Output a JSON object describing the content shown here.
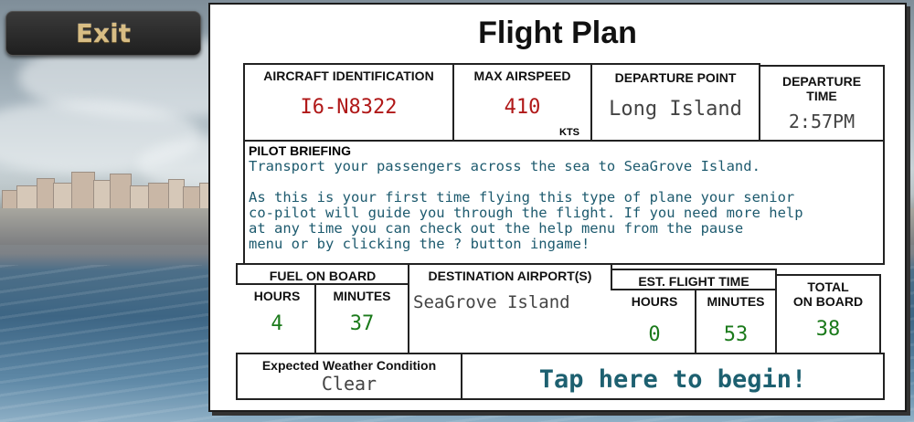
{
  "exit_button": {
    "label": "Exit"
  },
  "flight_plan": {
    "title": "Flight Plan",
    "aircraft_identification": {
      "label": "AIRCRAFT IDENTIFICATION",
      "value": "I6-N8322"
    },
    "max_airspeed": {
      "label": "MAX AIRSPEED",
      "value": "410",
      "unit": "KTS"
    },
    "departure_point": {
      "label": "DEPARTURE POINT",
      "value": "Long Island"
    },
    "departure_time": {
      "label_line1": "DEPARTURE",
      "label_line2": "TIME",
      "value": "2:57PM"
    },
    "pilot_briefing": {
      "label": "PILOT BRIEFING",
      "line1": "Transport your passengers across the sea to SeaGrove Island.",
      "para2_line1": "As this is your first time flying this type of plane your senior",
      "para2_line2": "co-pilot will guide you through the flight. If you need more help",
      "para2_line3": "at any time you can check out the help menu from the pause",
      "para2_line4": "menu or by clicking the ? button ingame!"
    },
    "fuel_on_board": {
      "label": "FUEL ON BOARD",
      "hours_label": "HOURS",
      "minutes_label": "MINUTES",
      "hours": "4",
      "minutes": "37"
    },
    "destination": {
      "label": "DESTINATION AIRPORT(S)",
      "value": "SeaGrove Island"
    },
    "est_flight_time": {
      "label": "EST. FLIGHT TIME",
      "hours_label": "HOURS",
      "minutes_label": "MINUTES",
      "hours": "0",
      "minutes": "53"
    },
    "total_on_board": {
      "label_line1": "TOTAL",
      "label_line2": "ON BOARD",
      "value": "38"
    },
    "weather": {
      "label": "Expected Weather Condition",
      "value": "Clear"
    },
    "begin_button": {
      "label": "Tap here to begin!"
    }
  },
  "colors": {
    "red_ink": "#b01818",
    "green_ink": "#1b7a1b",
    "blue_ink": "#1d6070",
    "exit_text": "#d8bd84"
  }
}
